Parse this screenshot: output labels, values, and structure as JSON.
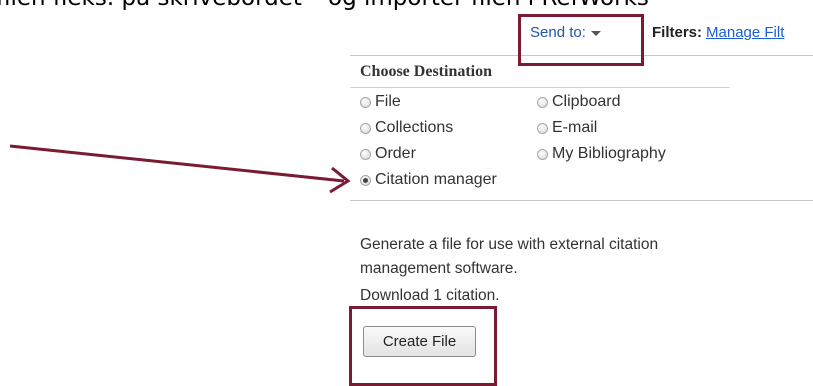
{
  "header": {
    "caption": "filen fieks. på skrivebordet – og importer filen i RefWorks"
  },
  "toolbar": {
    "send_to_label": "Send to:",
    "filters_label": "Filters:",
    "manage_filters_link": "Manage Filt"
  },
  "panel": {
    "title": "Choose Destination",
    "options": [
      {
        "label": "File",
        "selected": false
      },
      {
        "label": "Clipboard",
        "selected": false
      },
      {
        "label": "Collections",
        "selected": false
      },
      {
        "label": "E-mail",
        "selected": false
      },
      {
        "label": "Order",
        "selected": false
      },
      {
        "label": "My Bibliography",
        "selected": false
      },
      {
        "label": "Citation manager",
        "selected": true
      }
    ],
    "description": "Generate a file for use with external citation management software.",
    "download_text": "Download 1 citation.",
    "create_button": "Create File"
  },
  "annotations": {
    "highlight_color": "#7a1a33",
    "arrow_color": "#7a1a33"
  }
}
